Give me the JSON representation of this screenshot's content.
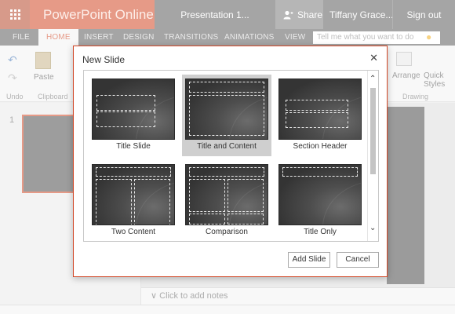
{
  "app": {
    "name": "PowerPoint Online",
    "document_title": "Presentation 1...",
    "share_label": "Share",
    "user_name": "Tiffany Grace...",
    "signout_label": "Sign out"
  },
  "ribbon_tabs": [
    "FILE",
    "HOME",
    "INSERT",
    "DESIGN",
    "TRANSITIONS",
    "ANIMATIONS",
    "VIEW"
  ],
  "active_tab": "HOME",
  "tellme": {
    "placeholder": "Tell me what you want to do"
  },
  "ribbon": {
    "undo_label": "Undo",
    "paste_label": "Paste",
    "clipboard_label": "Clipboard",
    "arrange_label": "Arrange",
    "quick_styles_label": "Quick Styles",
    "drawing_label": "Drawing"
  },
  "thumbnails": {
    "slide_number": "1"
  },
  "notes": {
    "placeholder": "Click to add notes"
  },
  "dialog": {
    "title": "New Slide",
    "layouts": [
      {
        "label": "Title Slide",
        "selected": false
      },
      {
        "label": "Title and Content",
        "selected": true
      },
      {
        "label": "Section Header",
        "selected": false
      },
      {
        "label": "Two Content",
        "selected": false
      },
      {
        "label": "Comparison",
        "selected": false
      },
      {
        "label": "Title Only",
        "selected": false
      }
    ],
    "add_button": "Add Slide",
    "cancel_button": "Cancel"
  },
  "colors": {
    "brand": "#d24726",
    "dark_bar": "#5b5b5b",
    "selection": "#cfcfcf"
  }
}
